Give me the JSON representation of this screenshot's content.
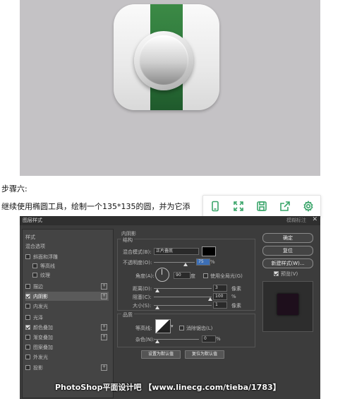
{
  "article": {
    "step_title": "步骤六:",
    "step_body": "继续使用椭圆工具，绘制一个135*135的圆，并为它添"
  },
  "toolbar": {
    "icons": [
      "phone-icon",
      "expand-icon",
      "save-icon",
      "share-icon",
      "settings-icon"
    ],
    "accent": "#3aa56a"
  },
  "dialog": {
    "title": "图层样式",
    "blurred_title": "模糊标注",
    "close": "✕",
    "styles_header": "样式",
    "blend_options": "混合选项",
    "layer_effects": [
      {
        "label": "斜面和浮雕",
        "checked": false,
        "plus": false
      },
      {
        "label": "等高线",
        "checked": false,
        "plus": false
      },
      {
        "label": "纹理",
        "checked": false,
        "plus": false
      },
      {
        "label": "描边",
        "checked": false,
        "plus": true
      },
      {
        "label": "内阴影",
        "checked": true,
        "plus": true
      },
      {
        "label": "内发光",
        "checked": false,
        "plus": false
      },
      {
        "label": "光泽",
        "checked": false,
        "plus": false
      },
      {
        "label": "颜色叠加",
        "checked": true,
        "plus": true
      },
      {
        "label": "渐变叠加",
        "checked": false,
        "plus": true
      },
      {
        "label": "图案叠加",
        "checked": false,
        "plus": false
      },
      {
        "label": "外发光",
        "checked": false,
        "plus": false
      },
      {
        "label": "投影",
        "checked": false,
        "plus": true
      }
    ],
    "inner_shadow": {
      "section": "内阴影",
      "structure": "结构",
      "blend_mode_label": "混合模式(B):",
      "blend_mode_value": "正片叠底",
      "shadow_color": "#000000",
      "opacity_label": "不透明度(O):",
      "opacity_value": "75",
      "angle_label": "角度(A):",
      "angle_value": "90",
      "angle_unit": "度",
      "global_light_label": "使用全局光(G)",
      "distance_label": "距离(D):",
      "distance_value": "3",
      "choke_label": "阻塞(C):",
      "choke_value": "100",
      "size_label": "大小(S):",
      "size_value": "1",
      "px_unit": "像素",
      "percent_unit": "%",
      "quality": "品质",
      "contour_label": "等高线:",
      "anti_alias_label": "消除锯齿(L)",
      "noise_label": "杂色(N):",
      "noise_value": "0",
      "make_default": "设置为默认值",
      "reset_default": "复位为默认值"
    },
    "right": {
      "ok": "确定",
      "reset": "复位",
      "new_style": "新建样式(W)...",
      "preview_label": "预览(V)",
      "preview_checked": true
    }
  },
  "watermark": "PhotoShop平面设计吧 【www.linecg.com/tieba/1783】"
}
